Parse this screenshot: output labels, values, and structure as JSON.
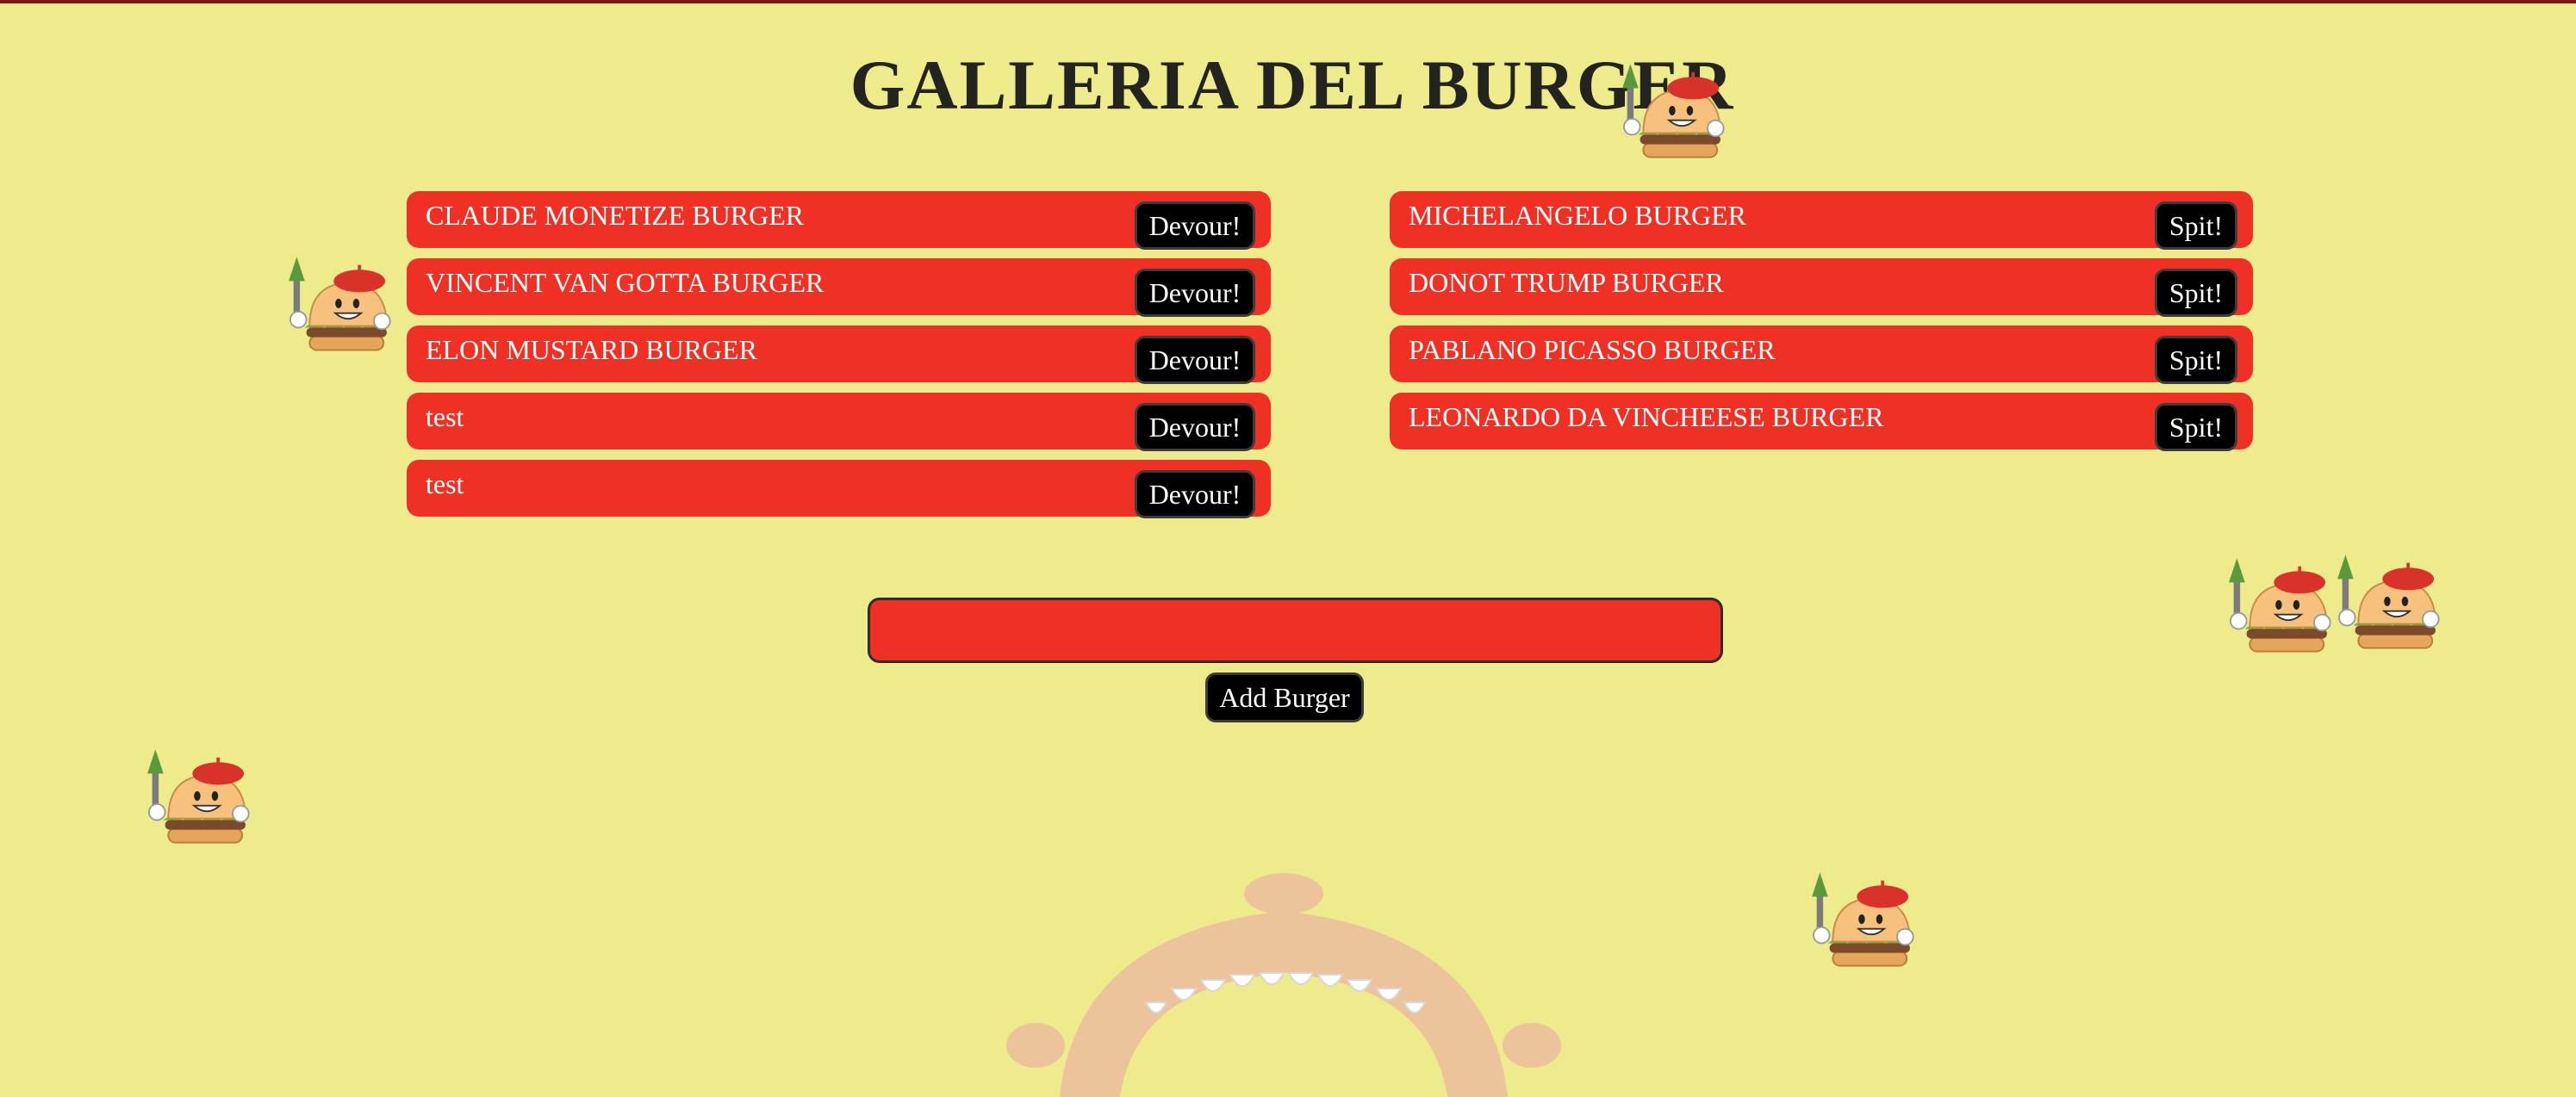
{
  "page": {
    "title": "GALLERIA DEL BURGER",
    "background_color": "#eeeb8d",
    "accent_color": "#ee3124"
  },
  "uneaten": {
    "button_label": "Devour!",
    "items": [
      {
        "name": "CLAUDE MONETIZE BURGER"
      },
      {
        "name": "VINCENT VAN GOTTA BURGER"
      },
      {
        "name": "ELON MUSTARD BURGER"
      },
      {
        "name": "test"
      },
      {
        "name": "test"
      }
    ]
  },
  "devoured": {
    "button_label": "Spit!",
    "items": [
      {
        "name": "MICHELANGELO BURGER"
      },
      {
        "name": "DONOT TRUMP BURGER"
      },
      {
        "name": "PABLANO PICASSO BURGER"
      },
      {
        "name": "LEONARDO DA VINCHEESE BURGER"
      }
    ]
  },
  "form": {
    "input_value": "",
    "input_placeholder": "",
    "submit_label": "Add Burger"
  },
  "decorations": {
    "mascot_icon": "burger-artist-mascot-icon",
    "mouth_icon": "open-mouth-icon"
  }
}
